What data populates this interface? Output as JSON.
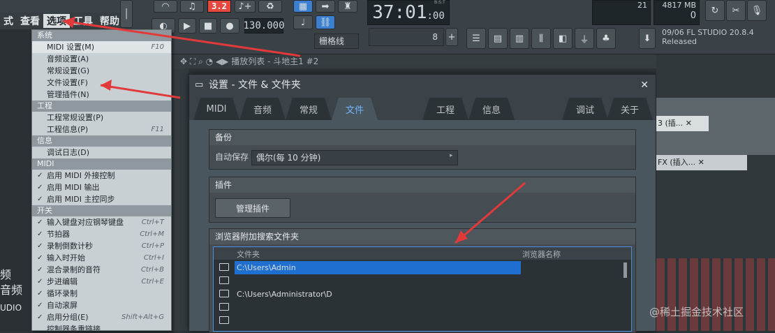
{
  "menu": {
    "items": [
      "式",
      "查看",
      "选项",
      "工具",
      "帮助"
    ],
    "active_index": 2
  },
  "transport": {
    "tempo": "130.000",
    "time": "37:01",
    "time_small": ":00",
    "time_tag": "B:S:T",
    "snap": "栅格线",
    "pattern_num": "8"
  },
  "meters": {
    "cpu": "21",
    "memory": "4817 MB",
    "voices": "0"
  },
  "news": {
    "date": "09/06",
    "title": "FL STUDIO 20.8.4",
    "status": "Released"
  },
  "playlist_title": "播放列表 - 斗地主1 #2",
  "dropdown": {
    "sections": [
      {
        "header": "系统",
        "items": [
          {
            "label": "MIDI 设置(M)",
            "shortcut": "F10",
            "checked": false,
            "highlight": true
          },
          {
            "label": "音频设置(A)",
            "shortcut": "",
            "checked": false
          },
          {
            "label": "常规设置(G)",
            "shortcut": "",
            "checked": false
          },
          {
            "label": "文件设置(F)",
            "shortcut": "",
            "checked": false
          },
          {
            "label": "管理插件(N)",
            "shortcut": "",
            "checked": false
          }
        ]
      },
      {
        "header": "工程",
        "items": [
          {
            "label": "工程常规设置(P)",
            "shortcut": "",
            "checked": false
          },
          {
            "label": "工程信息(P)",
            "shortcut": "F11",
            "checked": false
          }
        ]
      },
      {
        "header": "信息",
        "items": [
          {
            "label": "调试日志(D)",
            "shortcut": "",
            "checked": false
          }
        ]
      },
      {
        "header": "MIDI",
        "items": [
          {
            "label": "启用 MIDI 外接控制",
            "shortcut": "",
            "checked": true
          },
          {
            "label": "启用 MIDI 输出",
            "shortcut": "",
            "checked": true
          },
          {
            "label": "启用 MIDI 主控同步",
            "shortcut": "",
            "checked": true
          }
        ]
      },
      {
        "header": "开关",
        "items": [
          {
            "label": "输入键盘对应钢琴键盘",
            "shortcut": "Ctrl+T",
            "checked": true
          },
          {
            "label": "节拍器",
            "shortcut": "Ctrl+M",
            "checked": true
          },
          {
            "label": "录制倒数计秒",
            "shortcut": "Ctrl+P",
            "checked": true
          },
          {
            "label": "输入时开始",
            "shortcut": "Ctrl+I",
            "checked": true
          },
          {
            "label": "混合录制的音符",
            "shortcut": "Ctrl+B",
            "checked": true
          },
          {
            "label": "步进编辑",
            "shortcut": "Ctrl+E",
            "checked": true
          },
          {
            "label": "循环录制",
            "shortcut": "",
            "checked": true
          },
          {
            "label": "自动滚屏",
            "shortcut": "",
            "checked": true
          },
          {
            "label": "启用分组(E)",
            "shortcut": "Shift+Alt+G",
            "checked": true
          },
          {
            "label": "控制器条重链接",
            "shortcut": "",
            "checked": false
          }
        ]
      }
    ]
  },
  "left_labels": [
    "频",
    "音频",
    "UDIO"
  ],
  "dialog": {
    "title": "设置 - 文件 & 文件夹",
    "tabs": [
      "MIDI",
      "音频",
      "常规",
      "文件",
      "工程",
      "信息",
      "调试",
      "关于"
    ],
    "active_tab": 3,
    "backup": {
      "header": "备份",
      "autosave_label": "自动保存",
      "autosave_value": "偶尔(每 10 分钟)"
    },
    "plugins": {
      "header": "插件",
      "manage_button": "管理插件"
    },
    "browser": {
      "header": "浏览器附加搜索文件夹",
      "col_folder": "文件夹",
      "col_name": "浏览器名称",
      "rows": [
        "C:\\Users\\Admin",
        "",
        "C:\\Users\\Administrator\\D",
        "",
        ""
      ]
    }
  },
  "right_labels": {
    "track1": "3 (插...",
    "track2": "FX (插入..."
  },
  "watermark": "@稀土掘金技术社区",
  "colors": {
    "accent": "#4a90e2",
    "highlight_row": "#1f6fd0",
    "lcd_red": "#e8493f",
    "arrow": "#e23a3a"
  }
}
